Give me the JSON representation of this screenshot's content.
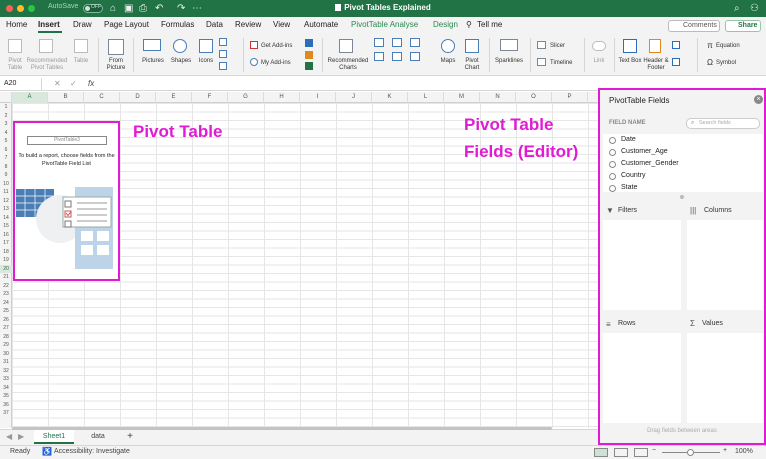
{
  "titlebar": {
    "autosave_label": "AutoSave",
    "autosave_state": "OFF",
    "document_title": "Pivot Tables Explained",
    "icons": [
      "home-icon",
      "save-icon",
      "print-icon",
      "undo-icon",
      "redo-icon",
      "more-icon",
      "search-icon",
      "share-icon"
    ],
    "colors": {
      "bar": "#217346",
      "close": "#ff5f57",
      "minimize": "#febc2e",
      "maximize": "#28c840"
    }
  },
  "menu": {
    "tabs": [
      "Home",
      "Insert",
      "Draw",
      "Page Layout",
      "Formulas",
      "Data",
      "Review",
      "View",
      "Automate",
      "PivotTable Analyse",
      "Design",
      "Tell me"
    ],
    "active_tab": "Insert",
    "comments_label": "Comments",
    "share_label": "Share"
  },
  "ribbon": {
    "pivot_table": "Pivot Table",
    "recommended_pivot": "Recommended Pivot Tables",
    "table": "Table",
    "from_picture": "From Picture",
    "pictures": "Pictures",
    "shapes": "Shapes",
    "icons": "Icons",
    "get_addins": "Get Add-ins",
    "my_addins": "My Add-ins",
    "recommended_charts": "Recommended Charts",
    "maps": "Maps",
    "pivot_chart": "Pivot Chart",
    "sparklines": "Sparklines",
    "slicer": "Slicer",
    "timeline": "Timeline",
    "link": "Link",
    "text_box": "Text Box",
    "header_footer": "Header & Footer",
    "equation": "Equation",
    "symbol": "Symbol"
  },
  "formula_bar": {
    "name_box": "A20",
    "fx": "fx",
    "formula": ""
  },
  "grid": {
    "columns": [
      "A",
      "B",
      "C",
      "D",
      "E",
      "F",
      "G",
      "H",
      "I",
      "J",
      "K",
      "L",
      "M",
      "N",
      "O",
      "P"
    ],
    "selected_column": "A",
    "rows": [
      "1",
      "2",
      "3",
      "4",
      "5",
      "6",
      "7",
      "8",
      "9",
      "10",
      "11",
      "12",
      "13",
      "14",
      "15",
      "16",
      "17",
      "18",
      "19",
      "20",
      "21",
      "22",
      "23",
      "24",
      "25",
      "26",
      "27",
      "28",
      "29",
      "30",
      "31",
      "32",
      "33",
      "34",
      "35",
      "36",
      "37"
    ],
    "selected_row": "20"
  },
  "pivot_placeholder": {
    "name": "PivotTable3",
    "instruction": "To build a report, choose fields from the PivotTable Field List"
  },
  "annotations": {
    "pivot_table": "Pivot Table",
    "fields_editor_line1": "Pivot Table",
    "fields_editor_line2": "Fields (Editor)",
    "color": "#e01bd3"
  },
  "sheets": {
    "tabs": [
      "Sheet1",
      "data"
    ],
    "active": "Sheet1",
    "add_label": "+"
  },
  "status": {
    "ready": "Ready",
    "accessibility": "Accessibility: Investigate",
    "zoom": "100%"
  },
  "fields_pane": {
    "title": "PivotTable Fields",
    "field_name_header": "FIELD NAME",
    "search_placeholder": "Search fields",
    "fields": [
      "Date",
      "Customer_Age",
      "Customer_Gender",
      "Country",
      "State"
    ],
    "areas": {
      "filters": "Filters",
      "columns": "Columns",
      "rows": "Rows",
      "values": "Values"
    },
    "footer": "Drag fields between areas"
  }
}
